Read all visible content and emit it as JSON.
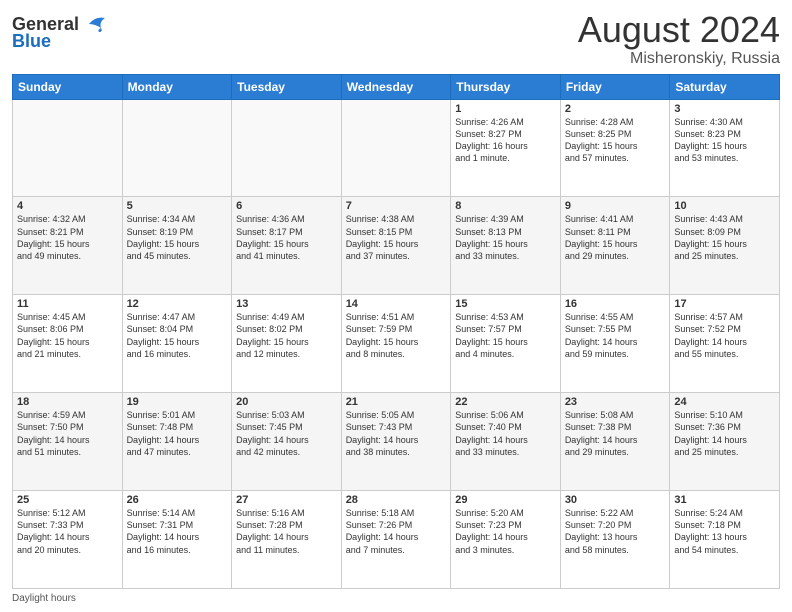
{
  "header": {
    "logo_general": "General",
    "logo_blue": "Blue",
    "month_title": "August 2024",
    "location": "Misheronskiy, Russia"
  },
  "days_of_week": [
    "Sunday",
    "Monday",
    "Tuesday",
    "Wednesday",
    "Thursday",
    "Friday",
    "Saturday"
  ],
  "weeks": [
    [
      {
        "day": "",
        "info": ""
      },
      {
        "day": "",
        "info": ""
      },
      {
        "day": "",
        "info": ""
      },
      {
        "day": "",
        "info": ""
      },
      {
        "day": "1",
        "info": "Sunrise: 4:26 AM\nSunset: 8:27 PM\nDaylight: 16 hours\nand 1 minute."
      },
      {
        "day": "2",
        "info": "Sunrise: 4:28 AM\nSunset: 8:25 PM\nDaylight: 15 hours\nand 57 minutes."
      },
      {
        "day": "3",
        "info": "Sunrise: 4:30 AM\nSunset: 8:23 PM\nDaylight: 15 hours\nand 53 minutes."
      }
    ],
    [
      {
        "day": "4",
        "info": "Sunrise: 4:32 AM\nSunset: 8:21 PM\nDaylight: 15 hours\nand 49 minutes."
      },
      {
        "day": "5",
        "info": "Sunrise: 4:34 AM\nSunset: 8:19 PM\nDaylight: 15 hours\nand 45 minutes."
      },
      {
        "day": "6",
        "info": "Sunrise: 4:36 AM\nSunset: 8:17 PM\nDaylight: 15 hours\nand 41 minutes."
      },
      {
        "day": "7",
        "info": "Sunrise: 4:38 AM\nSunset: 8:15 PM\nDaylight: 15 hours\nand 37 minutes."
      },
      {
        "day": "8",
        "info": "Sunrise: 4:39 AM\nSunset: 8:13 PM\nDaylight: 15 hours\nand 33 minutes."
      },
      {
        "day": "9",
        "info": "Sunrise: 4:41 AM\nSunset: 8:11 PM\nDaylight: 15 hours\nand 29 minutes."
      },
      {
        "day": "10",
        "info": "Sunrise: 4:43 AM\nSunset: 8:09 PM\nDaylight: 15 hours\nand 25 minutes."
      }
    ],
    [
      {
        "day": "11",
        "info": "Sunrise: 4:45 AM\nSunset: 8:06 PM\nDaylight: 15 hours\nand 21 minutes."
      },
      {
        "day": "12",
        "info": "Sunrise: 4:47 AM\nSunset: 8:04 PM\nDaylight: 15 hours\nand 16 minutes."
      },
      {
        "day": "13",
        "info": "Sunrise: 4:49 AM\nSunset: 8:02 PM\nDaylight: 15 hours\nand 12 minutes."
      },
      {
        "day": "14",
        "info": "Sunrise: 4:51 AM\nSunset: 7:59 PM\nDaylight: 15 hours\nand 8 minutes."
      },
      {
        "day": "15",
        "info": "Sunrise: 4:53 AM\nSunset: 7:57 PM\nDaylight: 15 hours\nand 4 minutes."
      },
      {
        "day": "16",
        "info": "Sunrise: 4:55 AM\nSunset: 7:55 PM\nDaylight: 14 hours\nand 59 minutes."
      },
      {
        "day": "17",
        "info": "Sunrise: 4:57 AM\nSunset: 7:52 PM\nDaylight: 14 hours\nand 55 minutes."
      }
    ],
    [
      {
        "day": "18",
        "info": "Sunrise: 4:59 AM\nSunset: 7:50 PM\nDaylight: 14 hours\nand 51 minutes."
      },
      {
        "day": "19",
        "info": "Sunrise: 5:01 AM\nSunset: 7:48 PM\nDaylight: 14 hours\nand 47 minutes."
      },
      {
        "day": "20",
        "info": "Sunrise: 5:03 AM\nSunset: 7:45 PM\nDaylight: 14 hours\nand 42 minutes."
      },
      {
        "day": "21",
        "info": "Sunrise: 5:05 AM\nSunset: 7:43 PM\nDaylight: 14 hours\nand 38 minutes."
      },
      {
        "day": "22",
        "info": "Sunrise: 5:06 AM\nSunset: 7:40 PM\nDaylight: 14 hours\nand 33 minutes."
      },
      {
        "day": "23",
        "info": "Sunrise: 5:08 AM\nSunset: 7:38 PM\nDaylight: 14 hours\nand 29 minutes."
      },
      {
        "day": "24",
        "info": "Sunrise: 5:10 AM\nSunset: 7:36 PM\nDaylight: 14 hours\nand 25 minutes."
      }
    ],
    [
      {
        "day": "25",
        "info": "Sunrise: 5:12 AM\nSunset: 7:33 PM\nDaylight: 14 hours\nand 20 minutes."
      },
      {
        "day": "26",
        "info": "Sunrise: 5:14 AM\nSunset: 7:31 PM\nDaylight: 14 hours\nand 16 minutes."
      },
      {
        "day": "27",
        "info": "Sunrise: 5:16 AM\nSunset: 7:28 PM\nDaylight: 14 hours\nand 11 minutes."
      },
      {
        "day": "28",
        "info": "Sunrise: 5:18 AM\nSunset: 7:26 PM\nDaylight: 14 hours\nand 7 minutes."
      },
      {
        "day": "29",
        "info": "Sunrise: 5:20 AM\nSunset: 7:23 PM\nDaylight: 14 hours\nand 3 minutes."
      },
      {
        "day": "30",
        "info": "Sunrise: 5:22 AM\nSunset: 7:20 PM\nDaylight: 13 hours\nand 58 minutes."
      },
      {
        "day": "31",
        "info": "Sunrise: 5:24 AM\nSunset: 7:18 PM\nDaylight: 13 hours\nand 54 minutes."
      }
    ]
  ],
  "footer": {
    "daylight_label": "Daylight hours"
  }
}
